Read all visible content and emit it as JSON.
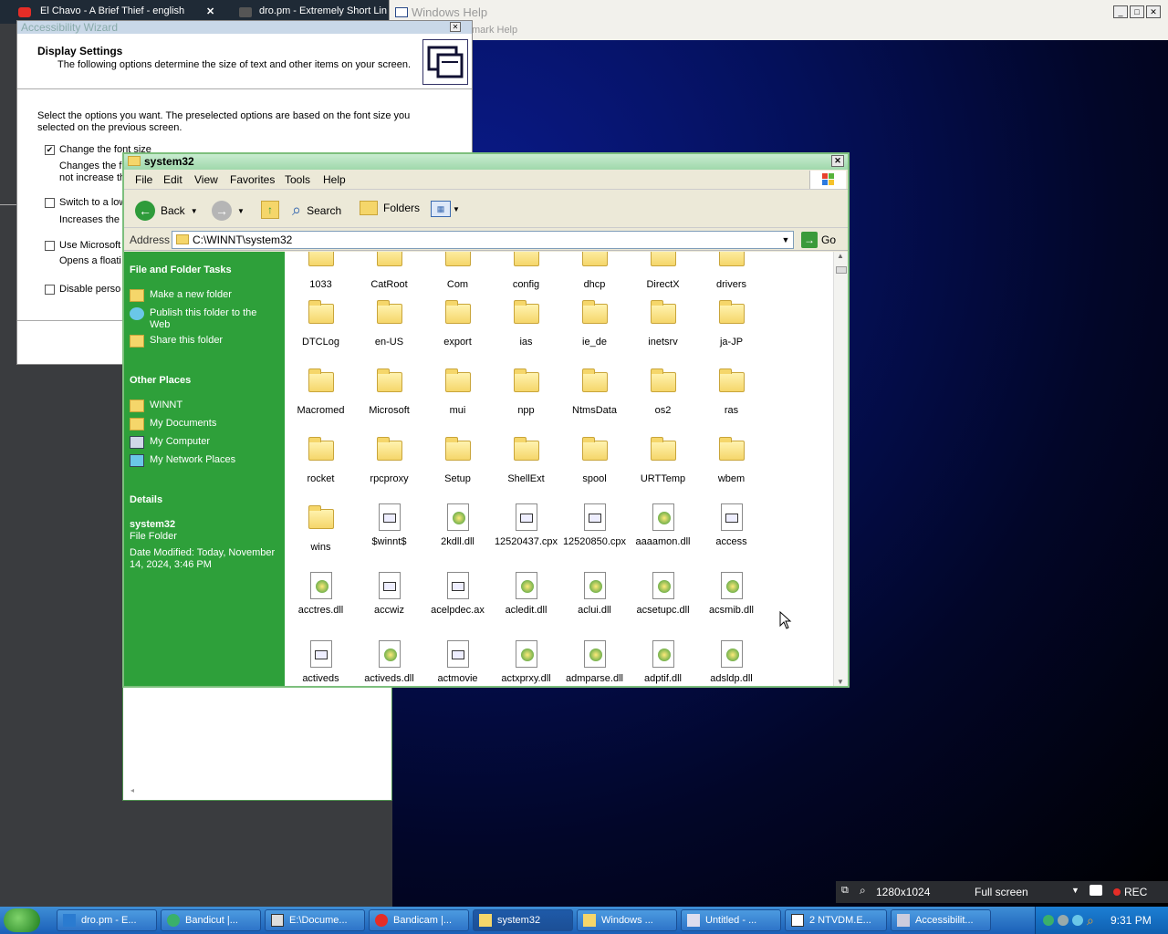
{
  "browser_tabs": [
    {
      "label": "El Chavo - A Brief Thief - english",
      "close": "✕"
    },
    {
      "label": "dro.pm - Extremely Short Lin"
    }
  ],
  "windows_help": {
    "title": "Windows Help",
    "menu": "mark  Help"
  },
  "wizard": {
    "title": "Accessibility Wizard",
    "heading": "Display Settings",
    "subheading": "The following options determine the size of text and other items on your screen.",
    "intro": "Select the options you want.  The preselected options are based on the font size you selected on the previous screen.",
    "options": [
      {
        "label": "Change the font size",
        "desc": "Changes the f",
        "desc2": "not increase th",
        "checked": true
      },
      {
        "label": "Switch to a low",
        "desc": "Increases the",
        "checked": false
      },
      {
        "label": "Use Microsoft",
        "desc": "Opens a floati",
        "checked": false
      },
      {
        "label": "Disable perso",
        "checked": false
      }
    ]
  },
  "explorer": {
    "title": "system32",
    "menu": [
      "File",
      "Edit",
      "View",
      "Favorites",
      "Tools",
      "Help"
    ],
    "toolbar": {
      "back": "Back",
      "search": "Search",
      "folders": "Folders"
    },
    "address_label": "Address",
    "address": "C:\\WINNT\\system32",
    "go": "Go",
    "side": {
      "tasks_heading": "File and Folder Tasks",
      "tasks": [
        "Make a new folder",
        "Publish this folder to the Web",
        "Share this folder"
      ],
      "places_heading": "Other Places",
      "places": [
        "WINNT",
        "My Documents",
        "My Computer",
        "My Network Places"
      ],
      "details_heading": "Details",
      "details_name": "system32",
      "details_type": "File Folder",
      "details_modified": "Date Modified: Today, November 14, 2024, 3:46 PM"
    },
    "rows": [
      [
        {
          "name": "1033",
          "kind": "folder"
        },
        {
          "name": "CatRoot",
          "kind": "folder"
        },
        {
          "name": "Com",
          "kind": "folder"
        },
        {
          "name": "config",
          "kind": "folder"
        },
        {
          "name": "dhcp",
          "kind": "folder"
        },
        {
          "name": "DirectX",
          "kind": "folder"
        },
        {
          "name": "drivers",
          "kind": "folder"
        }
      ],
      [
        {
          "name": "DTCLog",
          "kind": "folder"
        },
        {
          "name": "en-US",
          "kind": "folder"
        },
        {
          "name": "export",
          "kind": "folder"
        },
        {
          "name": "ias",
          "kind": "folder"
        },
        {
          "name": "ie_de",
          "kind": "folder"
        },
        {
          "name": "inetsrv",
          "kind": "folder"
        },
        {
          "name": "ja-JP",
          "kind": "folder"
        }
      ],
      [
        {
          "name": "Macromed",
          "kind": "folder"
        },
        {
          "name": "Microsoft",
          "kind": "folder"
        },
        {
          "name": "mui",
          "kind": "folder"
        },
        {
          "name": "npp",
          "kind": "folder"
        },
        {
          "name": "NtmsData",
          "kind": "folder"
        },
        {
          "name": "os2",
          "kind": "folder"
        },
        {
          "name": "ras",
          "kind": "folder"
        }
      ],
      [
        {
          "name": "rocket",
          "kind": "folder"
        },
        {
          "name": "rpcproxy",
          "kind": "folder"
        },
        {
          "name": "Setup",
          "kind": "folder"
        },
        {
          "name": "ShellExt",
          "kind": "folder"
        },
        {
          "name": "spool",
          "kind": "folder"
        },
        {
          "name": "URTTemp",
          "kind": "folder"
        },
        {
          "name": "wbem",
          "kind": "folder"
        }
      ],
      [
        {
          "name": "wins",
          "kind": "folder"
        },
        {
          "name": "$winnt$",
          "kind": "file"
        },
        {
          "name": "2kdll.dll",
          "kind": "dll"
        },
        {
          "name": "12520437.cpx",
          "kind": "file"
        },
        {
          "name": "12520850.cpx",
          "kind": "file"
        },
        {
          "name": "aaaamon.dll",
          "kind": "dll"
        },
        {
          "name": "access",
          "kind": "file"
        }
      ],
      [
        {
          "name": "acctres.dll",
          "kind": "dll"
        },
        {
          "name": "accwiz",
          "kind": "file"
        },
        {
          "name": "acelpdec.ax",
          "kind": "file"
        },
        {
          "name": "acledit.dll",
          "kind": "dll"
        },
        {
          "name": "aclui.dll",
          "kind": "dll"
        },
        {
          "name": "acsetupc.dll",
          "kind": "dll"
        },
        {
          "name": "acsmib.dll",
          "kind": "dll"
        }
      ],
      [
        {
          "name": "activeds",
          "kind": "file"
        },
        {
          "name": "activeds.dll",
          "kind": "dll"
        },
        {
          "name": "actmovie",
          "kind": "file"
        },
        {
          "name": "actxprxy.dll",
          "kind": "dll"
        },
        {
          "name": "admparse.dll",
          "kind": "dll"
        },
        {
          "name": "adptif.dll",
          "kind": "dll"
        },
        {
          "name": "adsldp.dll",
          "kind": "dll"
        }
      ]
    ]
  },
  "recorder": {
    "resolution": "1280x1024",
    "mode": "Full screen",
    "rec": "REC"
  },
  "taskbar": {
    "buttons": [
      "dro.pm - E...",
      "Bandicut |...",
      "E:\\Docume...",
      "Bandicam |...",
      "system32",
      "Windows ...",
      "Untitled - ...",
      "2 NTVDM.E...",
      "Accessibilit..."
    ],
    "active": "system32",
    "clock": "9:31 PM"
  },
  "colors": {
    "side_pane": "#2ea03a",
    "desktop": "#04105a",
    "taskbar": "#2e74c8"
  }
}
